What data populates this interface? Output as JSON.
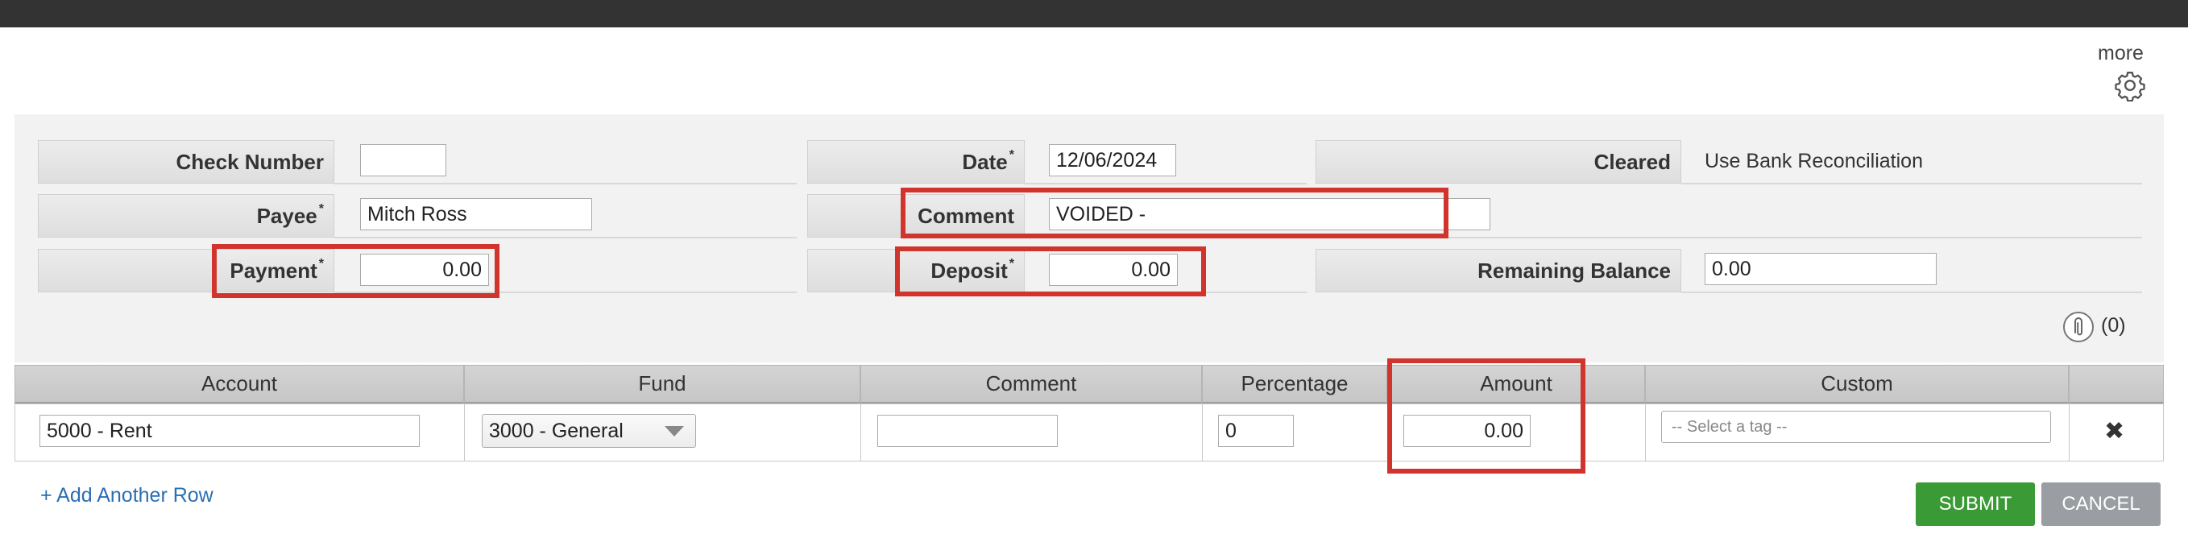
{
  "header": {
    "more_label": "more"
  },
  "form": {
    "check_number": {
      "label": "Check Number",
      "value": ""
    },
    "date": {
      "label": "Date",
      "required": "*",
      "value": "12/06/2024"
    },
    "cleared": {
      "label": "Cleared",
      "value": "Use Bank Reconciliation"
    },
    "payee": {
      "label": "Payee",
      "required": "*",
      "value": "Mitch Ross"
    },
    "comment": {
      "label": "Comment",
      "value": "VOIDED -"
    },
    "payment": {
      "label": "Payment",
      "required": "*",
      "value": "0.00"
    },
    "deposit": {
      "label": "Deposit",
      "required": "*",
      "value": "0.00"
    },
    "remaining_balance": {
      "label": "Remaining Balance",
      "value": "0.00"
    },
    "attachments": {
      "count": "(0)"
    }
  },
  "grid": {
    "headers": [
      "Account",
      "Fund",
      "Comment",
      "Percentage",
      "Amount",
      "Custom"
    ],
    "row": {
      "account": "5000 - Rent",
      "fund": "3000 - General",
      "comment": "",
      "percentage": "0",
      "amount": "0.00",
      "custom_placeholder": "-- Select a tag --"
    }
  },
  "actions": {
    "add_row": "+ Add Another Row",
    "submit": "SUBMIT",
    "cancel": "CANCEL"
  },
  "colors": {
    "highlight": "#d0342c",
    "submit": "#3a9a35",
    "cancel": "#9a9ea2",
    "link": "#2a6fb0"
  }
}
